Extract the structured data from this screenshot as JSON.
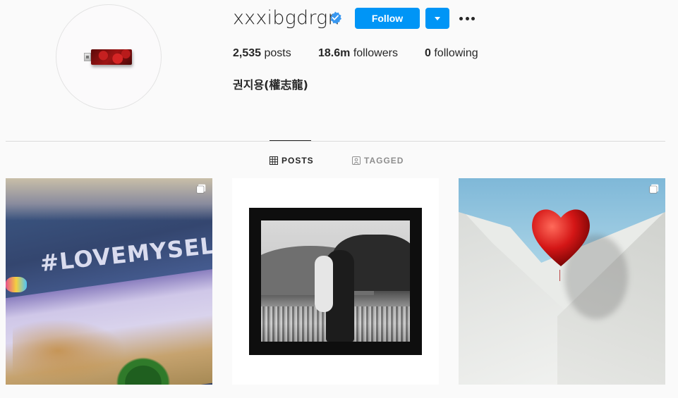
{
  "profile": {
    "username": "xxxibgdrgn",
    "verified": true,
    "follow_label": "Follow",
    "full_name": "권지용(權志龍)",
    "stats": {
      "posts_count": "2,535",
      "posts_label": "posts",
      "followers_count": "18.6m",
      "followers_label": "followers",
      "following_count": "0",
      "following_label": "following"
    }
  },
  "tabs": [
    {
      "label": "POSTS",
      "active": true,
      "icon": "grid-icon"
    },
    {
      "label": "TAGGED",
      "active": false,
      "icon": "tagged-icon"
    }
  ],
  "posts": [
    {
      "overlay_text": "#LOVEMYSELF",
      "multi": true
    },
    {
      "multi": false
    },
    {
      "multi": true
    }
  ],
  "colors": {
    "accent": "#0095f6",
    "text": "#262626",
    "muted": "#8e8e8e",
    "background": "#fafafa",
    "divider": "#dbdbdb"
  }
}
